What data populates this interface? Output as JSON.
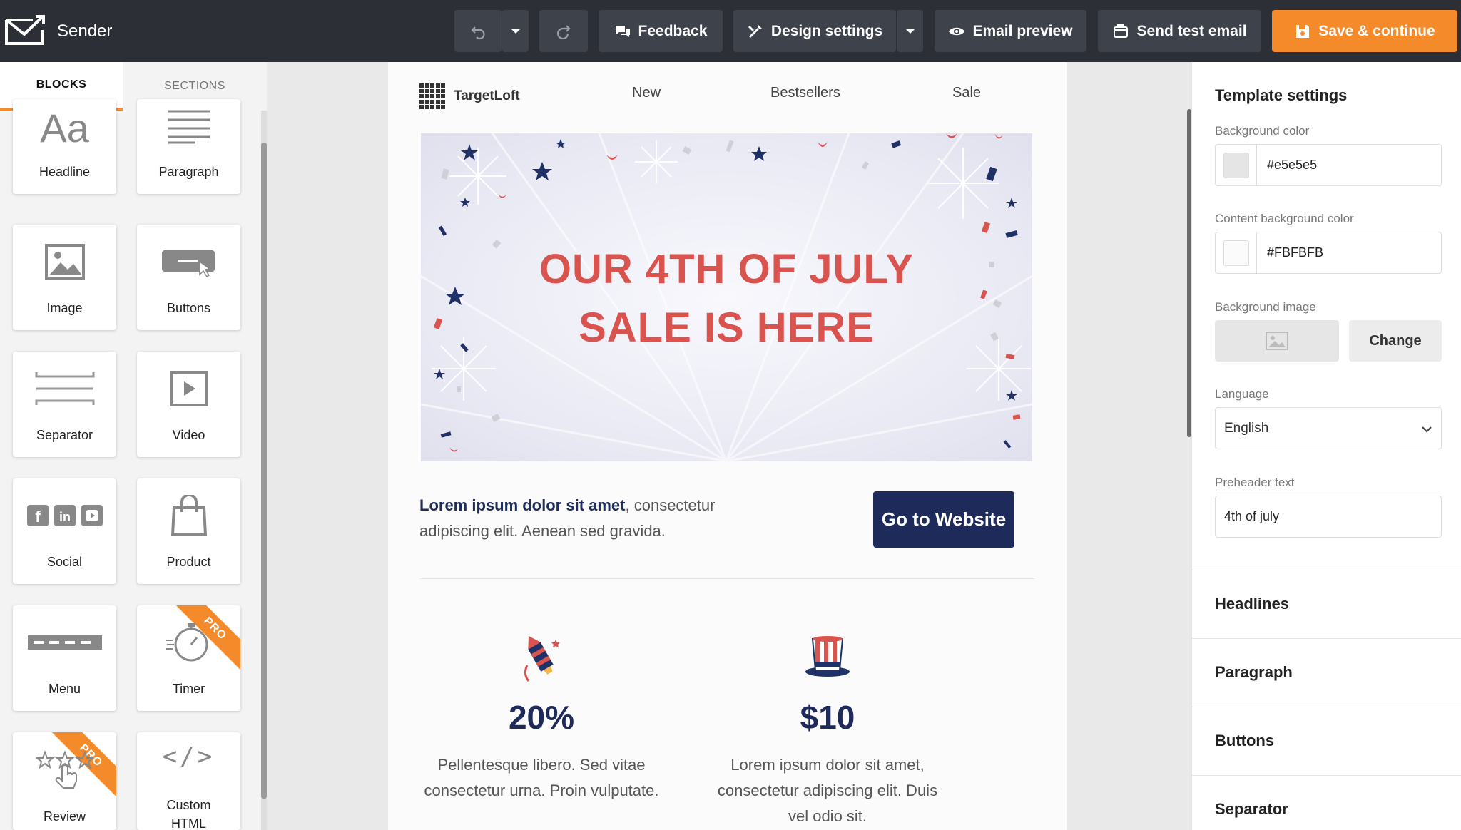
{
  "app": {
    "name": "Sender"
  },
  "toolbar": {
    "feedback": "Feedback",
    "design_settings": "Design settings",
    "email_preview": "Email preview",
    "send_test": "Send test email",
    "save": "Save & continue"
  },
  "left_panel": {
    "tabs": [
      "BLOCKS",
      "SECTIONS"
    ],
    "active_tab": "BLOCKS",
    "blocks": [
      {
        "label": "Headline",
        "icon": "headline-icon",
        "pro": false
      },
      {
        "label": "Paragraph",
        "icon": "paragraph-icon",
        "pro": false
      },
      {
        "label": "Image",
        "icon": "image-icon",
        "pro": false
      },
      {
        "label": "Buttons",
        "icon": "button-icon",
        "pro": false
      },
      {
        "label": "Separator",
        "icon": "separator-icon",
        "pro": false
      },
      {
        "label": "Video",
        "icon": "video-icon",
        "pro": false
      },
      {
        "label": "Social",
        "icon": "social-icon",
        "pro": false
      },
      {
        "label": "Product",
        "icon": "shopping-bag-icon",
        "pro": false
      },
      {
        "label": "Menu",
        "icon": "menu-icon",
        "pro": false
      },
      {
        "label": "Timer",
        "icon": "stopwatch-icon",
        "pro": true
      },
      {
        "label": "Review",
        "icon": "stars-icon",
        "pro": true
      },
      {
        "label": "Custom HTML",
        "icon": "code-icon",
        "pro": false
      }
    ],
    "pro_badge": "PRO"
  },
  "email": {
    "brand": "TargetLoft",
    "nav": [
      "New",
      "Bestsellers",
      "Sale"
    ],
    "hero_title_line1": "OUR 4TH OF JULY",
    "hero_title_line2": "SALE IS HERE",
    "intro_bold": "Lorem ipsum dolor sit amet",
    "intro_rest": ", consectetur adipiscing elit. Aenean sed gravida.",
    "cta": "Go to Website",
    "features": [
      {
        "icon": "firework-rocket-icon",
        "value": "20%",
        "desc": "Pellentesque libero. Sed vitae consectetur urna. Proin vulputate."
      },
      {
        "icon": "uncle-sam-hat-icon",
        "value": "$10",
        "desc": "Lorem ipsum dolor sit amet, consectetur adipiscing elit. Duis vel odio sit."
      }
    ]
  },
  "template_settings": {
    "title": "Template settings",
    "background_color_label": "Background color",
    "background_color": "#e5e5e5",
    "content_bg_label": "Content background color",
    "content_bg": "#FBFBFB",
    "background_image_label": "Background image",
    "change": "Change",
    "language_label": "Language",
    "language": "English",
    "preheader_label": "Preheader text",
    "preheader": "4th of july",
    "sections": [
      "Headlines",
      "Paragraph",
      "Buttons",
      "Separator"
    ]
  },
  "colors": {
    "accent": "#f58a2a",
    "topbar": "#2c2f36",
    "navy": "#1e2a5a",
    "hero_red": "#d9534f"
  }
}
